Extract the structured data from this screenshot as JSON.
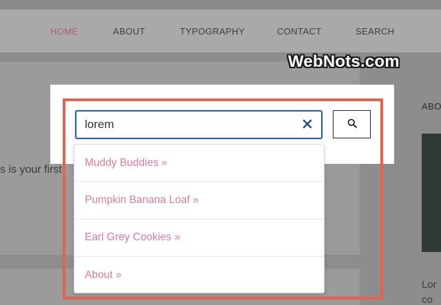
{
  "nav": {
    "items": [
      {
        "label": "HOME",
        "active": true
      },
      {
        "label": "ABOUT",
        "active": false
      },
      {
        "label": "TYPOGRAPHY",
        "active": false
      },
      {
        "label": "CONTACT",
        "active": false
      },
      {
        "label": "SEARCH",
        "active": false
      }
    ]
  },
  "background": {
    "partial_text": "s is your first",
    "side_heading": "ABO",
    "side_text_line1": "Lor",
    "side_text_line2": "co"
  },
  "search": {
    "value": "lorem",
    "clear_icon": "close-icon",
    "button_icon": "search-icon"
  },
  "suggestions": [
    {
      "label": "Muddy Buddies »"
    },
    {
      "label": "Pumpkin Banana Loaf »"
    },
    {
      "label": "Earl Grey Cookies »"
    },
    {
      "label": "About »"
    }
  ],
  "watermark": "WebNots.com",
  "colors": {
    "accent_link": "#e0799a",
    "input_border": "#2f5fa7",
    "highlight": "#e5624c",
    "nav_active": "#b05a76"
  }
}
